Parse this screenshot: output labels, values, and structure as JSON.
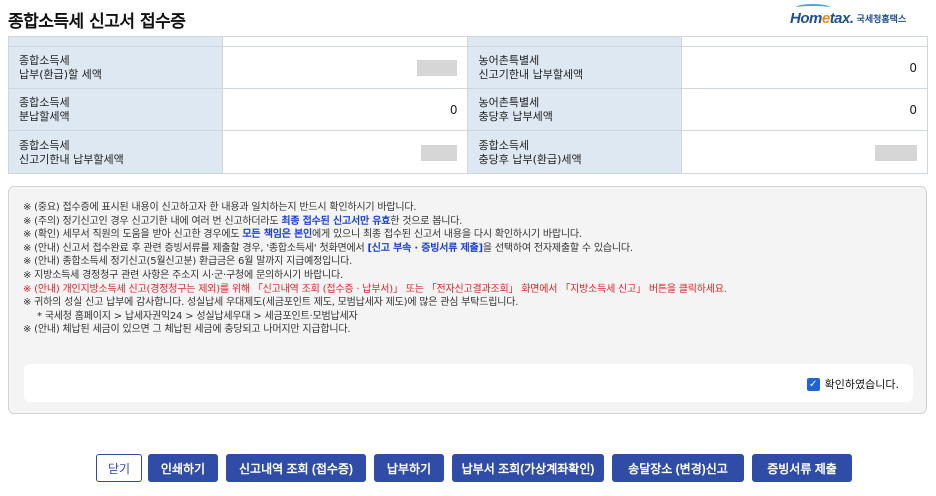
{
  "header": {
    "title": "종합소득세 신고서 접수증",
    "logo_brand_a": "Hom",
    "logo_brand_dot": "e",
    "logo_brand_b": "tax.",
    "logo_sub": "국세청홈택스"
  },
  "summary": {
    "row1": {
      "left_label_1": "종합소득세",
      "left_label_2": "납부(환급)할 세액",
      "left_value": "",
      "right_label_1": "농어촌특별세",
      "right_label_2": "신고기한내 납부할세액",
      "right_value": "0"
    },
    "row2": {
      "left_label_1": "종합소득세",
      "left_label_2": "분납할세액",
      "left_value": "0",
      "right_label_1": "농어촌특별세",
      "right_label_2": "충당후 납부세액",
      "right_value": "0"
    },
    "row3": {
      "left_label_1": "종합소득세",
      "left_label_2": "신고기한내 납부할세액",
      "left_value": "",
      "right_label_1": "종합소득세",
      "right_label_2": "충당후 납부(환급)세액",
      "right_value": ""
    }
  },
  "notice": {
    "l1": "※ (중요) 접수증에 표시된 내용이 신고하고자 한 내용과 일치하는지 반드시 확인하시기 바랍니다.",
    "l2a": "※ (주의) 정기신고인 경우 신고기한 내에 여러 번 신고하더라도 ",
    "l2b": "최종 접수된 신고서만 유효",
    "l2c": "한 것으로 봅니다.",
    "l3a": "※ (확인) 세무서 직원의 도움을 받아 신고한 경우에도 ",
    "l3b": "모든 책임은 본인",
    "l3c": "에게 있으니 최종 접수된 신고서 내용을 다시 확인하시기 바랍니다.",
    "l4a": "※ (안내) 신고서 접수완료 후 관련 증빙서류를 제출할 경우, '종합소득세' 첫화면에서 ",
    "l4b": "[신고 부속 · 증빙서류 제출]",
    "l4c": "을 선택하여 전자제출할 수 있습니다.",
    "l5": "※ (안내) 종합소득세 정기신고(5월신고분) 환급금은 6월 말까지 지급예정입니다.",
    "l6": "※ 지방소득세 경정청구 관련 사항은 주소지 시·군·구청에 문의하시기 바랍니다.",
    "l7": "※ (안내) 개인지방소득세 신고(경정청구는 제외)를 위해 「신고내역 조회 (접수증 · 납부서)」 또는 「전자신고결과조회」 화면에서 「지방소득세 신고」 버튼을 클릭하세요.",
    "l8": "※ 귀하의 성실 신고 납부에 감사합니다. 성실납세 우대제도(세금포인트 제도, 모범납세자 제도)에 많은 관심 부탁드립니다.",
    "l9": "* 국세청 홈페이지 > 납세자권익24 > 성실납세우대 > 세금포인트·모범납세자",
    "l10": "※ (안내) 체납된 세금이 있으면 그 체납된 세금에 충당되고 나머지만 지급합니다.",
    "confirm_label": "확인하였습니다."
  },
  "buttons": {
    "close": "닫기",
    "print": "인쇄하기",
    "history": "신고내역 조회 (접수증)",
    "pay": "납부하기",
    "bill": "납부서 조회(가상계좌확인)",
    "delivery": "송달장소 (변경)신고",
    "evidence": "증빙서류 제출"
  },
  "colors": {
    "label_bg": "#dde8f2",
    "primary": "#2f4da6",
    "alert_red": "#e0242a",
    "emphasis_blue": "#1a3fd6"
  }
}
